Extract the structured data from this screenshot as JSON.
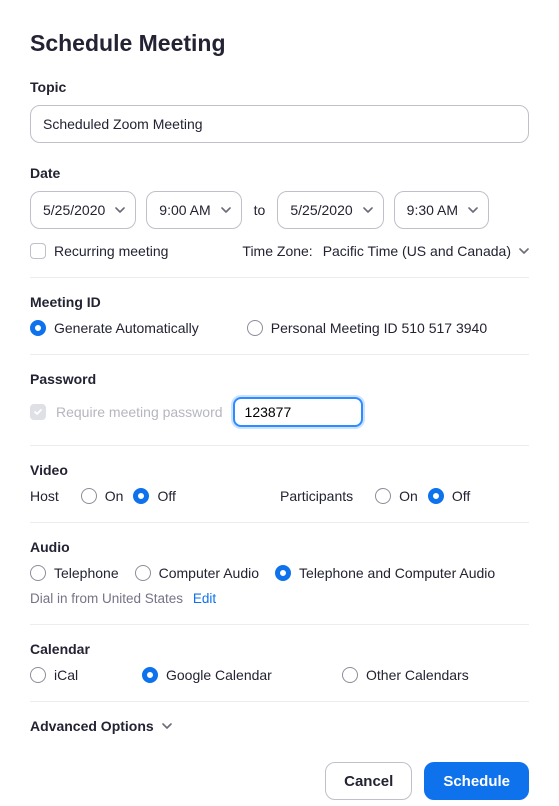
{
  "title": "Schedule Meeting",
  "topic": {
    "label": "Topic",
    "value": "Scheduled Zoom Meeting"
  },
  "date": {
    "label": "Date",
    "start_date": "5/25/2020",
    "start_time": "9:00 AM",
    "to": "to",
    "end_date": "5/25/2020",
    "end_time": "9:30 AM",
    "recurring_label": "Recurring meeting",
    "tz_prefix": "Time Zone:",
    "tz_value": "Pacific Time (US and Canada)"
  },
  "meeting_id": {
    "label": "Meeting ID",
    "auto_label": "Generate Automatically",
    "pmi_label": "Personal Meeting ID 510 517 3940"
  },
  "password": {
    "label": "Password",
    "require_label": "Require meeting password",
    "value": "123877"
  },
  "video": {
    "label": "Video",
    "host_label": "Host",
    "participants_label": "Participants",
    "on": "On",
    "off": "Off"
  },
  "audio": {
    "label": "Audio",
    "telephone": "Telephone",
    "computer": "Computer Audio",
    "both": "Telephone and Computer Audio",
    "dial_text": "Dial in from United States",
    "edit": "Edit"
  },
  "calendar": {
    "label": "Calendar",
    "ical": "iCal",
    "google": "Google Calendar",
    "other": "Other Calendars"
  },
  "advanced_label": "Advanced Options",
  "buttons": {
    "cancel": "Cancel",
    "schedule": "Schedule"
  }
}
